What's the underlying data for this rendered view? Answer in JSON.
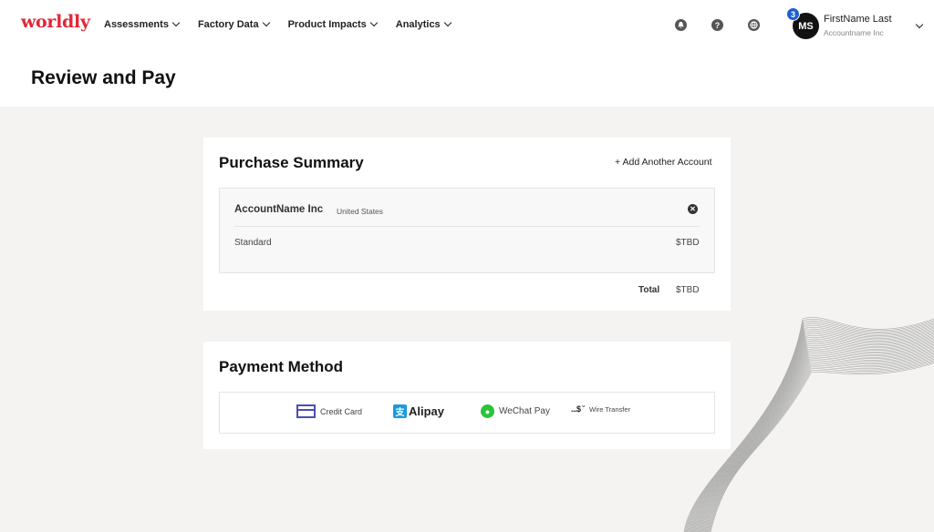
{
  "brand": {
    "logo": "worldly",
    "logo_color": "#e32636"
  },
  "nav": [
    {
      "label": "Assessments"
    },
    {
      "label": "Factory Data"
    },
    {
      "label": "Product Impacts"
    },
    {
      "label": "Analytics"
    }
  ],
  "header_icons": [
    "notifications-icon",
    "help-icon",
    "globe-icon"
  ],
  "user": {
    "initials": "MS",
    "badge_count": "3",
    "name": "FirstName Last",
    "org": "Accountname Inc"
  },
  "page": {
    "title": "Review and Pay"
  },
  "summary": {
    "title": "Purchase Summary",
    "add_account": "+ Add Another Account",
    "account_name": "AccountName Inc",
    "country": "United States",
    "plan": "Standard",
    "plan_price": "$TBD",
    "total_label": "Total",
    "total_value": "$TBD"
  },
  "payment": {
    "title": "Payment Method",
    "options": [
      {
        "label": "Credit Card",
        "icon": "credit-card-icon"
      },
      {
        "label": "Alipay",
        "icon": "alipay-icon",
        "mark": "支"
      },
      {
        "label": "WeChat Pay",
        "icon": "wechat-icon"
      },
      {
        "label": "Wire Transfer",
        "icon": "wire-transfer-icon",
        "mark": "...$ ˘"
      }
    ]
  },
  "colors": {
    "accent": "#1e5fd0",
    "card_brand": "#4b4fb4",
    "alipay": "#1a9ae0",
    "wechat": "#2ec23b"
  }
}
